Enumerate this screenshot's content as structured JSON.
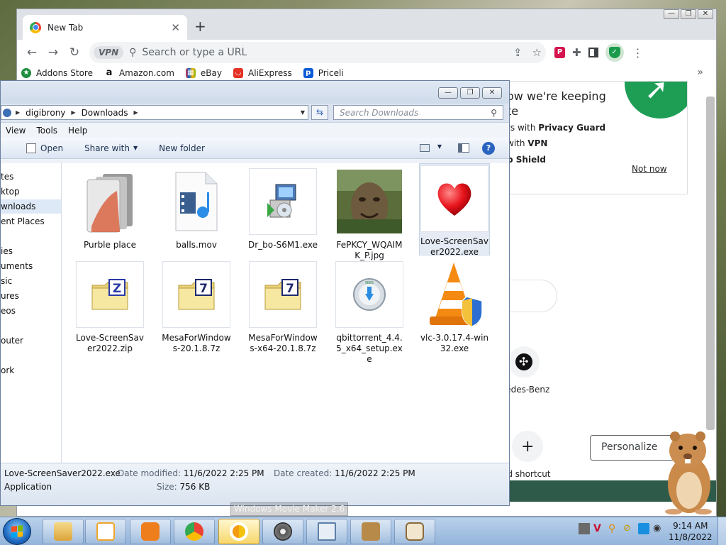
{
  "chrome": {
    "tab_title": "New Tab",
    "tab_close": "✕",
    "new_tab": "+",
    "window_controls": [
      "—",
      "❐",
      "✕"
    ],
    "vpn_badge": "VPN",
    "omnibox_placeholder": "Search or type a URL",
    "bookmarks": [
      {
        "label": "Addons Store",
        "icon_color": "#1e8e3e",
        "icon": "★"
      },
      {
        "label": "Amazon.com",
        "icon_color": "#111111",
        "icon": "a"
      },
      {
        "label": "eBay",
        "icon_color": "#e53238",
        "icon": "▦"
      },
      {
        "label": "AliExpress",
        "icon_color": "#e43225",
        "icon": "◡"
      },
      {
        "label": "Priceli",
        "icon_color": "#0a5bd6",
        "icon": "p"
      }
    ],
    "bookmarks_more": "»",
    "popup": {
      "title": "ow we're keeping\nte",
      "line1_prefix": "rs with ",
      "line1_bold": "Privacy Guard",
      "line2_prefix": "with ",
      "line2_bold": "VPN",
      "line3_bold": "p Shield",
      "not_now": "Not now",
      "arrow": "➚"
    },
    "shortcut_benz_label": "rcedes-Benz",
    "add_shortcut_label": "ld shortcut",
    "personalize": "Personalize"
  },
  "explorer": {
    "window_controls": [
      "—",
      "❐",
      "✕"
    ],
    "breadcrumb": [
      "digibrony",
      "Downloads"
    ],
    "search_placeholder": "Search Downloads",
    "menu": [
      "View",
      "Tools",
      "Help"
    ],
    "commands": {
      "open": "Open",
      "share": "Share with",
      "new_folder": "New folder"
    },
    "help": "?",
    "nav_items": [
      {
        "label": "tes",
        "selected": false
      },
      {
        "label": "ktop",
        "selected": false
      },
      {
        "label": "wnloads",
        "selected": true
      },
      {
        "label": "ent Places",
        "selected": false
      },
      {
        "label": "ies",
        "selected": false
      },
      {
        "label": "uments",
        "selected": false
      },
      {
        "label": "sic",
        "selected": false
      },
      {
        "label": "ures",
        "selected": false
      },
      {
        "label": "eos",
        "selected": false
      },
      {
        "label": "outer",
        "selected": false
      },
      {
        "label": "ork",
        "selected": false
      }
    ],
    "files": [
      {
        "name": "Purble place",
        "kind": "folder-docs",
        "selected": false
      },
      {
        "name": "balls.mov",
        "kind": "video",
        "selected": false
      },
      {
        "name": "Dr_bo-S6M1.exe",
        "kind": "installer",
        "selected": false
      },
      {
        "name": "FePKCY_WQAIMK_P.jpg",
        "kind": "photo-tree",
        "selected": false
      },
      {
        "name": "Love-ScreenSaver2022.exe",
        "kind": "heart",
        "selected": true
      },
      {
        "name": "Love-ScreenSaver2022.zip",
        "kind": "zip-z",
        "selected": false
      },
      {
        "name": "MesaForWindows-20.1.8.7z",
        "kind": "zip-7",
        "selected": false
      },
      {
        "name": "MesaForWindows-x64-20.1.8.7z",
        "kind": "zip-7",
        "selected": false
      },
      {
        "name": "qbittorrent_4.4.5_x64_setup.exe",
        "kind": "nsis",
        "selected": false
      },
      {
        "name": "vlc-3.0.17.4-win32.exe",
        "kind": "vlc",
        "selected": false
      }
    ],
    "details": {
      "name": "Love-ScreenSaver2022.exe",
      "type": "Application",
      "modified_label": "Date modified:",
      "modified": "11/6/2022 2:25 PM",
      "created_label": "Date created:",
      "created": "11/6/2022 2:25 PM",
      "size_label": "Size:",
      "size": "756 KB"
    }
  },
  "taskbar": {
    "tooltip": "Windows Movie Maker 2.6",
    "time": "9:14 AM",
    "date": "11/8/2022",
    "buttons": [
      {
        "name": "explorer",
        "color": "#e8b647",
        "active": false
      },
      {
        "name": "media-player",
        "color": "#f0a52c",
        "active": false
      },
      {
        "name": "uc-browser",
        "color": "#ee7d1b",
        "active": false
      },
      {
        "name": "chrome",
        "color": "#4285f4",
        "active": false
      },
      {
        "name": "chrome-canary",
        "color": "#f4c20d",
        "active": true
      },
      {
        "name": "movie-maker",
        "color": "#6d6d6d",
        "active": false
      },
      {
        "name": "window-app",
        "color": "#5b7fa8",
        "active": false
      },
      {
        "name": "hamster-box",
        "color": "#b88a4a",
        "active": false
      },
      {
        "name": "shield-app",
        "color": "#c9a070",
        "active": false
      }
    ]
  }
}
